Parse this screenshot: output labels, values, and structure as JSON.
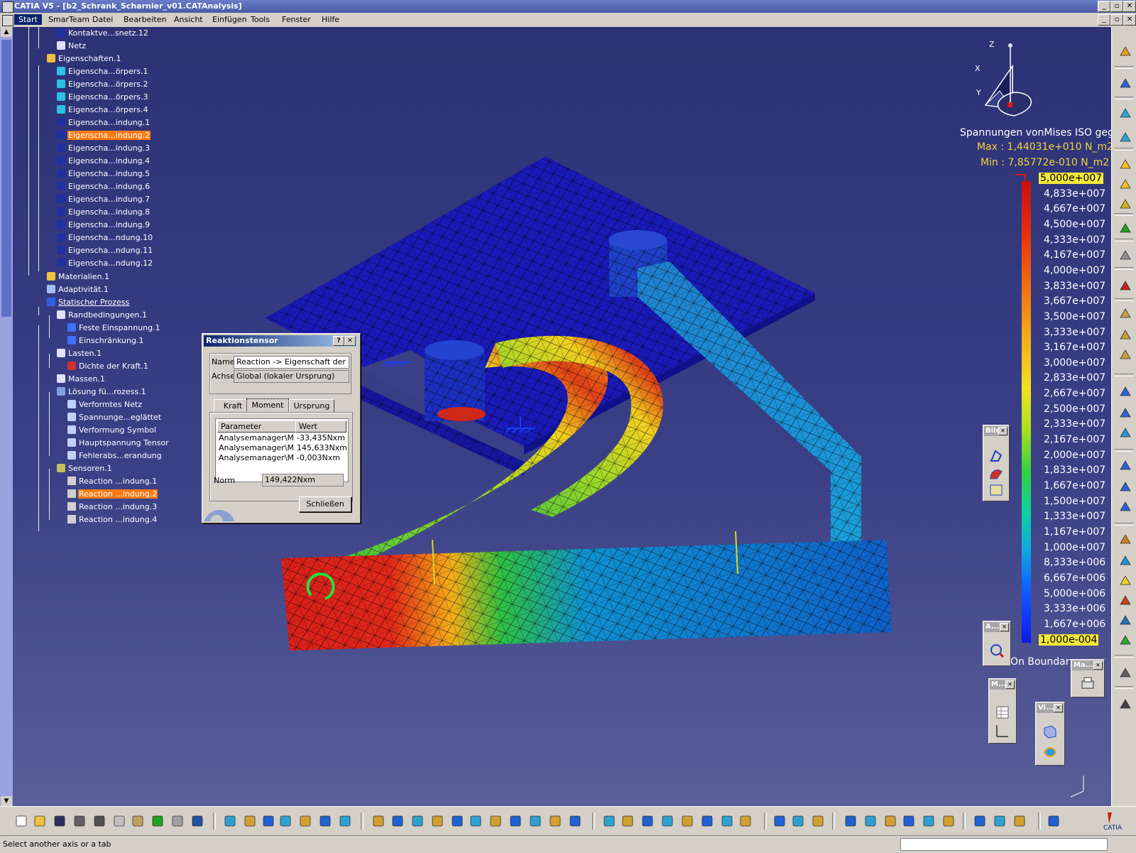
{
  "window": {
    "title": "CATIA V5 - [b2_Schrank_Scharnier_v01.CATAnalysis]"
  },
  "menu": [
    "Start",
    "SmarTeam",
    "Datei",
    "Bearbeiten",
    "Ansicht",
    "Einfügen",
    "Tools",
    "Fenster",
    "Hilfe"
  ],
  "tree": [
    {
      "label": "Kontaktve...snetz.12",
      "icon": "contact-mesh-icon"
    },
    {
      "label": "Netz",
      "icon": "mesh-icon"
    },
    {
      "label": "Eigenschaften.1",
      "icon": "folder-icon"
    },
    {
      "label": "Eigenscha...örpers.1",
      "icon": "solid-property-icon"
    },
    {
      "label": "Eigenscha...örpers.2",
      "icon": "solid-property-icon"
    },
    {
      "label": "Eigenscha...örpers.3",
      "icon": "solid-property-icon"
    },
    {
      "label": "Eigenscha...örpers.4",
      "icon": "solid-property-icon"
    },
    {
      "label": "Eigenscha...indung.1",
      "icon": "connection-property-icon"
    },
    {
      "label": "Eigenscha...indung.2",
      "icon": "connection-property-icon"
    },
    {
      "label": "Eigenscha...indung.3",
      "icon": "connection-property-icon"
    },
    {
      "label": "Eigenscha...indung.4",
      "icon": "connection-property-icon"
    },
    {
      "label": "Eigenscha...indung.5",
      "icon": "connection-property-icon"
    },
    {
      "label": "Eigenscha...indung.6",
      "icon": "connection-property-icon"
    },
    {
      "label": "Eigenscha...indung.7",
      "icon": "connection-property-icon"
    },
    {
      "label": "Eigenscha...indung.8",
      "icon": "connection-property-icon"
    },
    {
      "label": "Eigenscha...indung.9",
      "icon": "connection-property-icon"
    },
    {
      "label": "Eigenscha...ndung.10",
      "icon": "connection-property-icon"
    },
    {
      "label": "Eigenscha...ndung.11",
      "icon": "connection-property-icon"
    },
    {
      "label": "Eigenscha...ndung.12",
      "icon": "connection-property-icon"
    },
    {
      "label": "Materialien.1",
      "icon": "folder-icon"
    },
    {
      "label": "Adaptivität.1",
      "icon": "adaptivity-icon"
    },
    {
      "label": "Statischer Prozess",
      "icon": "static-case-icon"
    },
    {
      "label": "Randbedingungen.1",
      "icon": "restraints-set-icon"
    },
    {
      "label": "Feste Einspannung.1",
      "icon": "clamp-icon"
    },
    {
      "label": "Einschränkung.1",
      "icon": "restraint-icon"
    },
    {
      "label": "Lasten.1",
      "icon": "loads-set-icon"
    },
    {
      "label": "Dichte der Kraft.1",
      "icon": "force-density-icon"
    },
    {
      "label": "Massen.1",
      "icon": "masses-set-icon"
    },
    {
      "label": "Lösung fü...rozess.1",
      "icon": "solution-icon"
    },
    {
      "label": "Verformtes Netz",
      "icon": "image-icon"
    },
    {
      "label": "Spannunge...eglättet",
      "icon": "image-icon"
    },
    {
      "label": "Verformung Symbol",
      "icon": "image-icon"
    },
    {
      "label": "Hauptspannung Tensor",
      "icon": "image-icon"
    },
    {
      "label": "Fehlerabs...erandung",
      "icon": "image-icon"
    },
    {
      "label": "Sensoren.1",
      "icon": "sensors-set-icon"
    },
    {
      "label": "Reaction ...indung.1",
      "icon": "sensor-icon"
    },
    {
      "label": "Reaction ...indung.2",
      "icon": "sensor-icon"
    },
    {
      "label": "Reaction ...indung.3",
      "icon": "sensor-icon"
    },
    {
      "label": "Reaction ...indung.4",
      "icon": "sensor-icon"
    }
  ],
  "dialog": {
    "title": "Reaktionstensor",
    "name_label": "Name",
    "name_value": "Reaction -> Eigenschaft der Kon",
    "axis_label": "Achse",
    "axis_value": "Global (lokaler Ursprung)",
    "tabs": [
      "Kraft",
      "Moment",
      "Ursprung"
    ],
    "active_tab": "Moment",
    "columns": [
      "Parameter",
      "Wert"
    ],
    "rows": [
      [
        "Analysemanager\\Mx",
        "-33,435Nxm"
      ],
      [
        "Analysemanager\\My",
        "145,633Nxm"
      ],
      [
        "Analysemanager\\Mz",
        "-0,003Nxm"
      ]
    ],
    "norm_label": "Norm",
    "norm_value": "149,422Nxm",
    "close_label": "Schließen"
  },
  "legend": {
    "title": "Spannungen vonMises ISO geglätt",
    "max": "Max : 1,44031e+010 N_m2",
    "min": "Min : 7,85772e-010 N_m2",
    "ticks": [
      "5,000e+007",
      "4,833e+007",
      "4,667e+007",
      "4,500e+007",
      "4,333e+007",
      "4,167e+007",
      "4,000e+007",
      "3,833e+007",
      "3,667e+007",
      "3,500e+007",
      "3,333e+007",
      "3,167e+007",
      "3,000e+007",
      "2,833e+007",
      "2,667e+007",
      "2,500e+007",
      "2,333e+007",
      "2,167e+007",
      "2,000e+007",
      "1,833e+007",
      "1,667e+007",
      "1,500e+007",
      "1,333e+007",
      "1,167e+007",
      "1,000e+007",
      "8,333e+006",
      "6,667e+006",
      "5,000e+006",
      "3,333e+006",
      "1,667e+006",
      "1,000e-004"
    ],
    "boundary": "On Boundary"
  },
  "compass": {
    "x": "X",
    "y": "Y",
    "z": "Z"
  },
  "palettes": {
    "bild": "Bild",
    "a": "A...",
    "m": "M...",
    "ma": "Ma...",
    "vi": "Vi..."
  },
  "status": {
    "message": "Select another axis or a tab"
  }
}
